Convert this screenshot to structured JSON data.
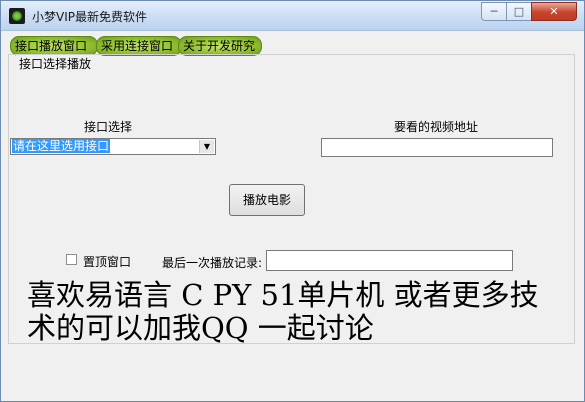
{
  "window": {
    "title": "小梦VIP最新免费软件",
    "minimize": "─",
    "maximize": "□",
    "close": "✕"
  },
  "tabs": [
    "接口播放窗口",
    "采用连接窗口",
    "关于开发研究"
  ],
  "group": {
    "legend": "接口选择播放",
    "interface_label": "接口选择",
    "interface_selected": "请在这里选用接口",
    "url_label": "要看的视频地址",
    "url_value": "",
    "play_button": "播放电影",
    "topmost_label": "置顶窗口",
    "topmost_checked": false,
    "last_record_label": "最后一次播放记录:",
    "last_record_value": ""
  },
  "message": "喜欢易语言 C  PY  51单片机 或者更多技术的可以加我QQ 一起讨论"
}
